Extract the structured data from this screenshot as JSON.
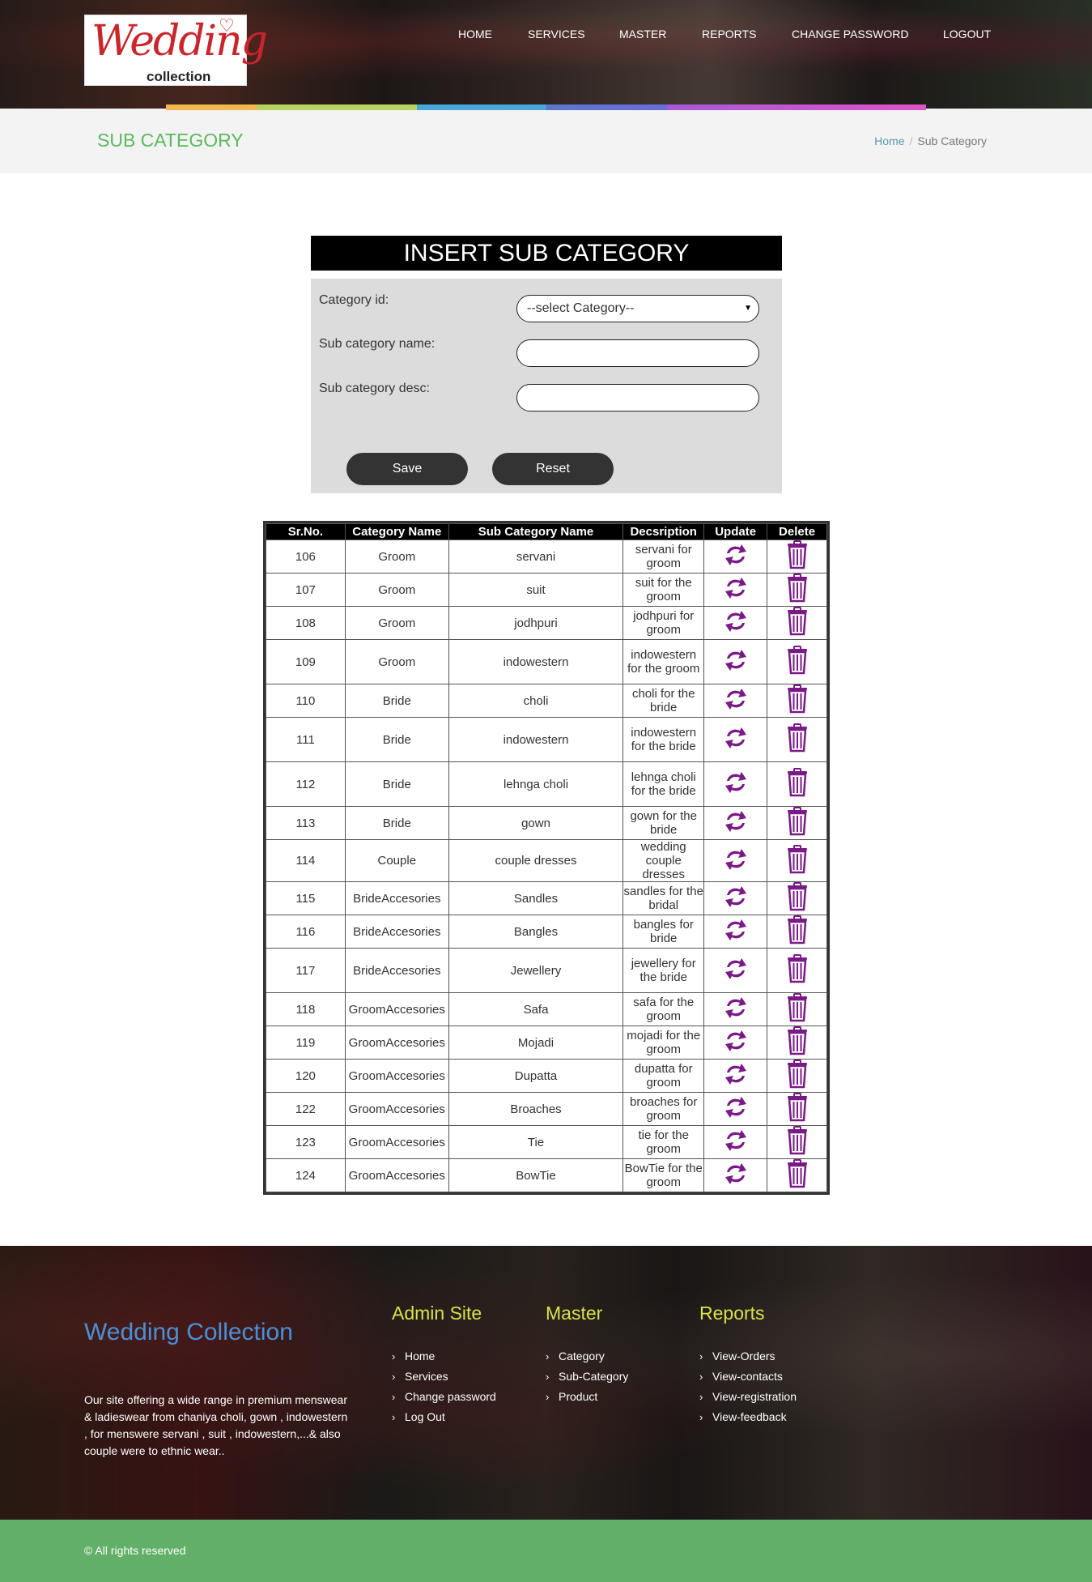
{
  "logo": {
    "script": "Wedding",
    "sub": "collection"
  },
  "nav": [
    "HOME",
    "SERVICES",
    "MASTER",
    "REPORTS",
    "CHANGE PASSWORD",
    "LOGOUT"
  ],
  "page": {
    "title": "SUB CATEGORY",
    "breadcrumb": {
      "home": "Home",
      "current": "Sub Category"
    }
  },
  "form": {
    "heading": "INSERT SUB CATEGORY",
    "category_label": "Category id:",
    "category_selected": "--select Category--",
    "name_label": "Sub category name:",
    "name_value": "",
    "desc_label": "Sub category desc:",
    "desc_value": "",
    "save": "Save",
    "reset": "Reset"
  },
  "table": {
    "headers": [
      "Sr.No.",
      "Category Name",
      "Sub Category Name",
      "Decsription",
      "Update",
      "Delete"
    ],
    "rows": [
      [
        "106",
        "Groom",
        "servani",
        "servani for groom"
      ],
      [
        "107",
        "Groom",
        "suit",
        "suit for the groom"
      ],
      [
        "108",
        "Groom",
        "jodhpuri",
        "jodhpuri for groom"
      ],
      [
        "109",
        "Groom",
        "indowestern",
        "indowestern for the groom"
      ],
      [
        "110",
        "Bride",
        "choli",
        "choli for the bride"
      ],
      [
        "111",
        "Bride",
        "indowestern",
        "indowestern for the bride"
      ],
      [
        "112",
        "Bride",
        "lehnga choli",
        "lehnga choli for the bride"
      ],
      [
        "113",
        "Bride",
        "gown",
        "gown for the bride"
      ],
      [
        "114",
        "Couple",
        "couple dresses",
        "wedding couple dresses"
      ],
      [
        "115",
        "BrideAccesories",
        "Sandles",
        "sandles for the bridal"
      ],
      [
        "116",
        "BrideAccesories",
        "Bangles",
        "bangles for bride"
      ],
      [
        "117",
        "BrideAccesories",
        "Jewellery",
        "jewellery for the bride"
      ],
      [
        "118",
        "GroomAccesories",
        "Safa",
        "safa for the groom"
      ],
      [
        "119",
        "GroomAccesories",
        "Mojadi",
        "mojadi for the groom"
      ],
      [
        "120",
        "GroomAccesories",
        "Dupatta",
        "dupatta for groom"
      ],
      [
        "122",
        "GroomAccesories",
        "Broaches",
        "broaches for groom"
      ],
      [
        "123",
        "GroomAccesories",
        "Tie",
        "tie for the groom"
      ],
      [
        "124",
        "GroomAccesories",
        "BowTie",
        "BowTie for the groom"
      ]
    ],
    "icon_color": "#7a1a86"
  },
  "footer": {
    "brand": "Wedding Collection",
    "about": "Our site offering a wide range in premium menswear & ladieswear from chaniya choli, gown , indowestern , for menswere servani , suit , indowestern,...& also couple were to ethnic wear..",
    "columns": [
      {
        "title": "Admin Site",
        "items": [
          "Home",
          "Services",
          "Change password",
          "Log Out"
        ]
      },
      {
        "title": "Master",
        "items": [
          "Category",
          "Sub-Category",
          "Product"
        ]
      },
      {
        "title": "Reports",
        "items": [
          "View-Orders",
          "View-contacts",
          "View-registration",
          "View-feedback"
        ]
      }
    ],
    "copyright": "© All rights reserved"
  },
  "colors": {
    "accent_green": "#5cb85c",
    "footer_title": "#d7e34a",
    "brand_blue": "#4a90d8",
    "bottom_bar": "#62b067"
  }
}
